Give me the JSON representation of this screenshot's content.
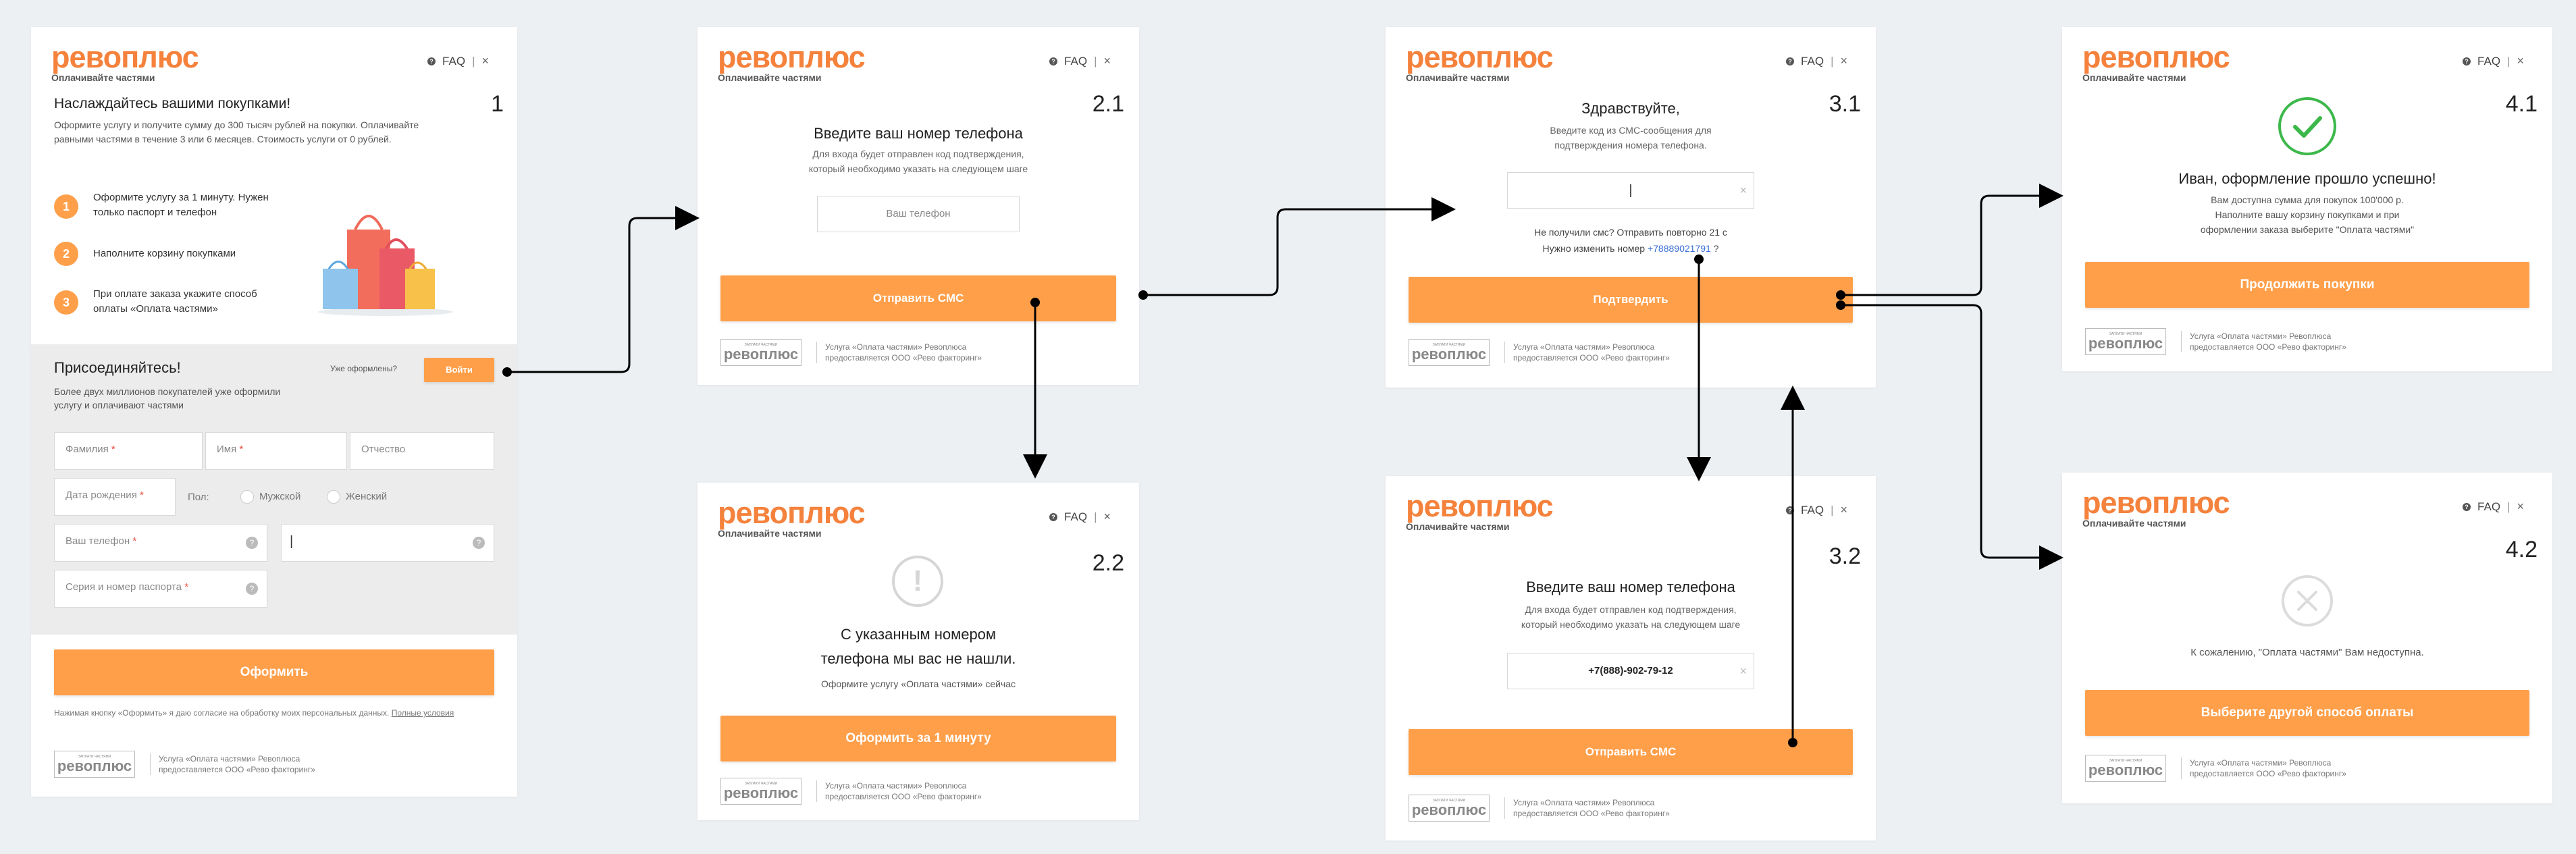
{
  "brand": {
    "logo": "ревоплюс",
    "tagline": "Оплачивайте частями",
    "footer_small": "ЗАПЛАТИ ЧАСТЯМИ",
    "footer_name": "ревоплюс"
  },
  "header": {
    "faq": "FAQ",
    "sep": "|",
    "close": "×",
    "q": "?"
  },
  "footer_text": "Услуга «Оплата частями» Ревоплюса предоставляется ООО «Ревo факторинг»",
  "screen1": {
    "number": "1",
    "title": "Наслаждайтесь вашими покупками!",
    "desc": "Оформите услугу и получите сумму до 300 тысяч рублей на покупки. Оплачивайте равными частями в течение 3 или 6 месяцев. Стоимость услуги от 0 рублей.",
    "steps": [
      {
        "n": "1",
        "text": "Оформите услугу за 1 минуту. Нужен только паспорт и телефон"
      },
      {
        "n": "2",
        "text": "Наполните корзину покупками"
      },
      {
        "n": "3",
        "text": "При оплате заказа укажите способ оплаты «Оплата частями»"
      }
    ],
    "join_title": "Присоединяйтесь!",
    "join_desc": "Более двух миллионов покупателей уже оформили услугу и оплачивают частями",
    "already": "Уже оформлены?",
    "login": "Войти",
    "fields": {
      "surname": "Фамилия",
      "name": "Имя",
      "patronymic": "Отчество",
      "birth": "Дата рождения",
      "gender": "Пол:",
      "male": "Мужской",
      "female": "Женский",
      "phone": "Ваш телефон",
      "passport": "Серия и номер паспорта",
      "star": "*"
    },
    "submit": "Оформить",
    "consent": "Нажимая кнопку «Оформить» я даю согласие на обработку моих персональных данных.",
    "consent_link": "Полные условия"
  },
  "screen21": {
    "number": "2.1",
    "title": "Введите ваш номер телефона",
    "desc1": "Для входа будет отправлен код подтверждения,",
    "desc2": "который необходимо указать на следующем шаге",
    "placeholder": "Ваш телефон",
    "button": "Отправить СМС"
  },
  "screen22": {
    "number": "2.2",
    "icon": "!",
    "title1": "С указанным номером",
    "title2": "телефона мы вас не нашли.",
    "desc": "Оформите услугу «Оплата частями» сейчас",
    "button": "Оформить за 1 минуту"
  },
  "screen31": {
    "number": "3.1",
    "title": "Здравствуйте,",
    "desc1": "Введите код из СМС-сообщения для",
    "desc2": "подтверждения номера телефона.",
    "resend": "Не получили смс? Отправить повторно 21 с",
    "change_prefix": "Нужно изменить номер ",
    "change_number": "+78889021791",
    "change_suffix": " ?",
    "button": "Подтвердить",
    "clear": "×"
  },
  "screen32": {
    "number": "3.2",
    "title": "Введите ваш номер телефона",
    "desc1": "Для входа будет отправлен код подтверждения,",
    "desc2": "который необходимо указать на следующем шаге",
    "value": "+7(888)-902-79-12",
    "clear": "×",
    "button": "Отправить СМС"
  },
  "screen41": {
    "number": "4.1",
    "title": "Иван, оформление прошло успешно!",
    "desc1": "Вам доступна сумма для покупок 100'000 р.",
    "desc2": "Наполните вашу корзину покупками и при",
    "desc3": "оформлении заказа выберите \"Оплата частями\"",
    "button": "Продолжить покупки"
  },
  "screen42": {
    "number": "4.2",
    "desc": "К сожалению, \"Оплата частями\" Вам недоступна.",
    "button": "Выберите другой способ оплаты"
  },
  "colors": {
    "accent": "#ff9f4a",
    "success": "#3cb84a",
    "link": "#3a6fd8"
  }
}
